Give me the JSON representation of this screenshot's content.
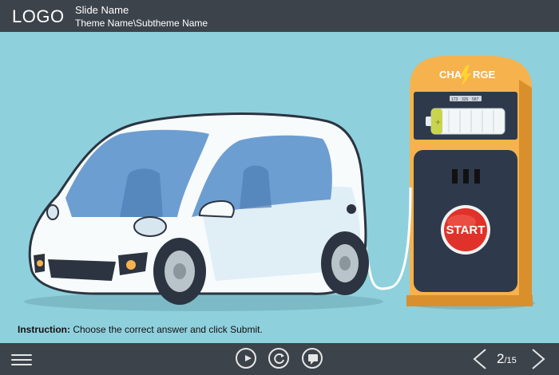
{
  "header": {
    "logo": "LOGO",
    "slide_name": "Slide Name",
    "theme_path": "Theme Name\\Subtheme Name"
  },
  "illustration": {
    "charge_label_left": "CHA",
    "charge_label_right": "RGE",
    "start_button_label": "START",
    "meter_segments": [
      "173",
      "326",
      "587"
    ]
  },
  "instruction": {
    "label": "Instruction:",
    "text": "Choose the correct answer and click Submit."
  },
  "footer": {
    "menu_icon": "hamburger-menu-icon",
    "play_icon": "play-icon",
    "replay_icon": "replay-icon",
    "comment_icon": "comment-icon",
    "prev_icon": "chevron-left-icon",
    "next_icon": "chevron-right-icon",
    "current_page": "2",
    "total_pages": "/15"
  },
  "colors": {
    "bar": "#3c434b",
    "background": "#8fd0dd",
    "station": "#f6b24d",
    "start_red": "#e0322a"
  }
}
